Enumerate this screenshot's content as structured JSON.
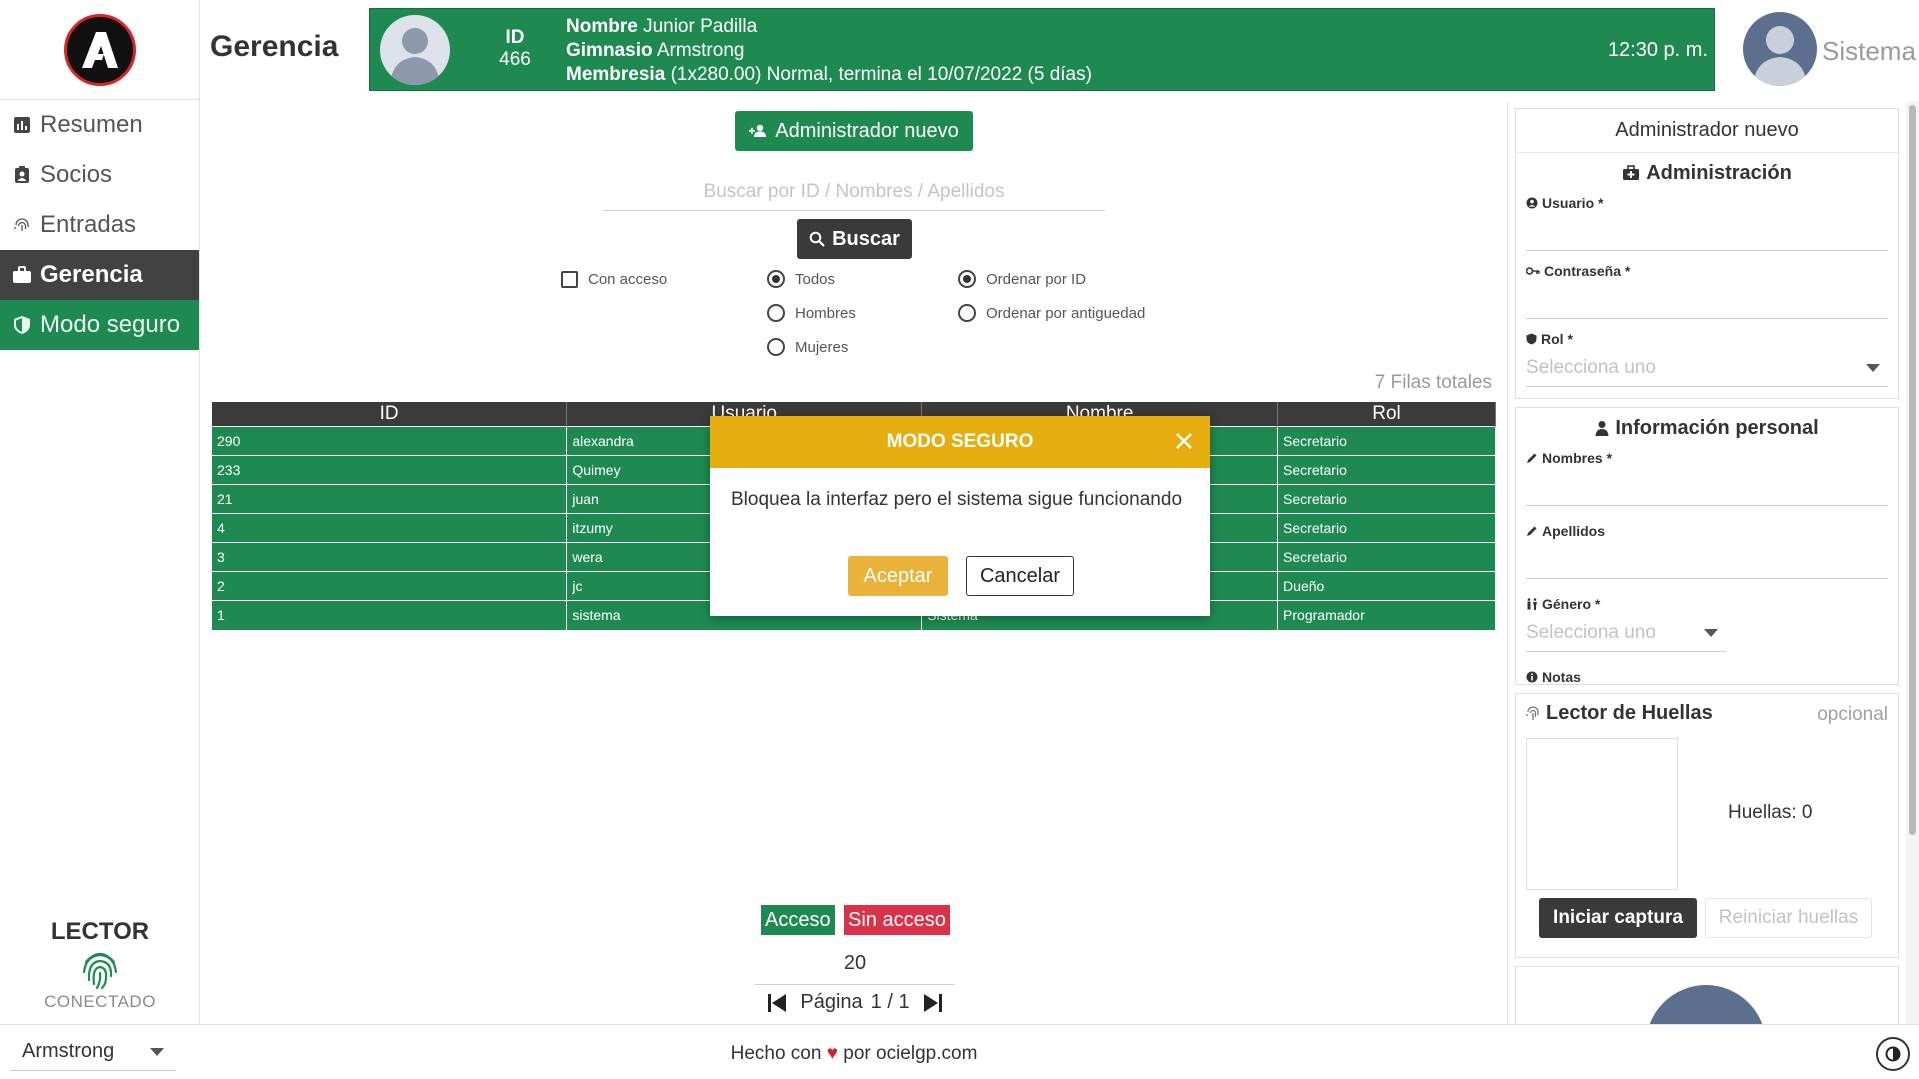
{
  "sidebar": {
    "items": [
      {
        "label": "Resumen",
        "icon": "chart-icon"
      },
      {
        "label": "Socios",
        "icon": "id-badge-icon"
      },
      {
        "label": "Entradas",
        "icon": "fingerprint-icon"
      },
      {
        "label": "Gerencia",
        "icon": "briefcase-icon",
        "active": true
      },
      {
        "label": "Modo seguro",
        "icon": "shield-icon"
      }
    ],
    "lector_title": "LECTOR",
    "lector_status": "CONECTADO"
  },
  "header": {
    "page_title": "Gerencia",
    "member": {
      "id_label": "ID",
      "id_value": "466",
      "name_label": "Nombre",
      "name_value": "Junior Padilla",
      "gym_label": "Gimnasio",
      "gym_value": "Armstrong",
      "membership_label": "Membresia",
      "membership_value": "(1x280.00) Normal, termina el 10/07/2022 (5 días)",
      "time": "12:30 p. m."
    },
    "user_name": "Sistema"
  },
  "main": {
    "new_admin_label": "Administrador nuevo",
    "search_placeholder": "Buscar por ID / Nombres / Apellidos",
    "search_button": "Buscar",
    "filters": {
      "access": "Con acceso",
      "gender_all": "Todos",
      "gender_men": "Hombres",
      "gender_women": "Mujeres",
      "order_id": "Ordenar por ID",
      "order_age": "Ordenar por antiguedad"
    },
    "total_rows": "7 Filas totales",
    "table": {
      "headers": [
        "ID",
        "Usuario",
        "Nombre",
        "Rol"
      ],
      "rows": [
        [
          "290",
          "alexandra",
          "",
          "Secretario"
        ],
        [
          "233",
          "Quimey",
          "",
          "Secretario"
        ],
        [
          "21",
          "juan",
          "",
          "Secretario"
        ],
        [
          "4",
          "itzumy",
          "",
          "Secretario"
        ],
        [
          "3",
          "wera",
          "",
          "Secretario"
        ],
        [
          "2",
          "jc",
          "",
          "Dueño"
        ],
        [
          "1",
          "sistema",
          "Sistema",
          "Programador"
        ]
      ]
    },
    "legend_access": "Acceso",
    "legend_no_access": "Sin acceso",
    "page_size": "20",
    "pager_label": "Página",
    "pager_value": "1 / 1"
  },
  "modal": {
    "title": "MODO SEGURO",
    "message": "Bloquea la interfaz pero el sistema sigue funcionando",
    "accept": "Aceptar",
    "cancel": "Cancelar"
  },
  "panel": {
    "title": "Administrador nuevo",
    "admin_section": "Administración",
    "user_label": "Usuario *",
    "password_label": "Contraseña *",
    "role_label": "Rol *",
    "role_placeholder": "Selecciona uno",
    "personal_section": "Información personal",
    "names_label": "Nombres *",
    "surnames_label": "Apellidos",
    "gender_label": "Género *",
    "gender_placeholder": "Selecciona uno",
    "notes_label": "Notas",
    "fingerprint_title": "Lector de Huellas",
    "fingerprint_optional": "opcional",
    "fingerprint_count": "Huellas: 0",
    "capture_button": "Iniciar captura",
    "reset_button": "Reiniciar huellas"
  },
  "footer": {
    "gym": "Armstrong",
    "made_with": "Hecho con",
    "heart": "♥",
    "by": "por ocielgp.com"
  },
  "colors": {
    "green": "#1e8a52",
    "dark": "#3b3b3b",
    "red": "#d9334a",
    "yellow": "#e5ae0e"
  }
}
